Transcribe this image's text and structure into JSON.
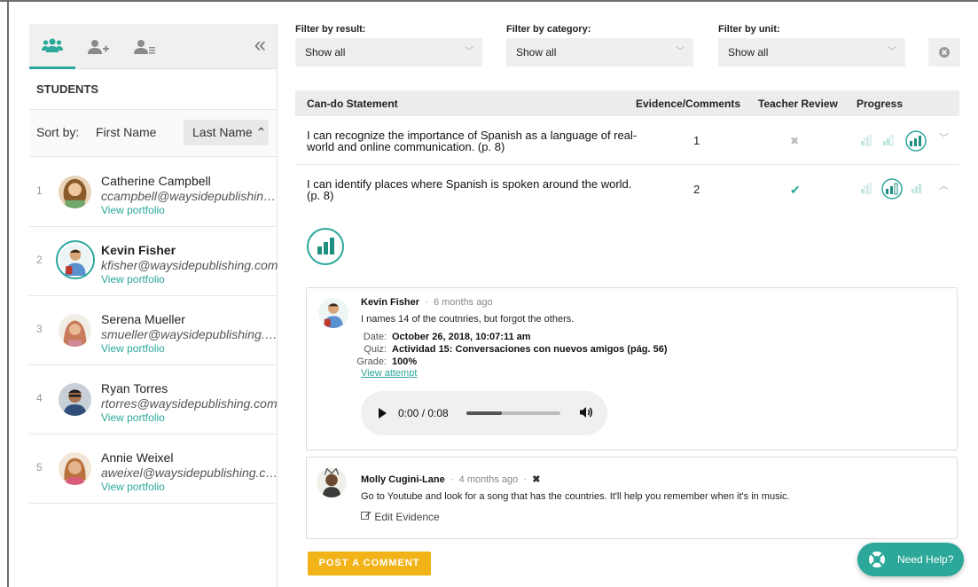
{
  "sidebar": {
    "students_heading": "STUDENTS",
    "sort_label": "Sort by:",
    "sort_first": "First Name",
    "sort_last": "Last Name ⌃",
    "collapse_glyph": "«",
    "students": [
      {
        "num": "1",
        "name": "Catherine Campbell",
        "email": "ccampbell@waysidepublishing.com",
        "portfolio": "View portfolio"
      },
      {
        "num": "2",
        "name": "Kevin Fisher",
        "email": "kfisher@waysidepublishing.com",
        "portfolio": "View portfolio"
      },
      {
        "num": "3",
        "name": "Serena Mueller",
        "email": "smueller@waysidepublishing.com",
        "portfolio": "View portfolio"
      },
      {
        "num": "4",
        "name": "Ryan Torres",
        "email": "rtorres@waysidepublishing.com",
        "portfolio": "View portfolio"
      },
      {
        "num": "5",
        "name": "Annie Weixel",
        "email": "aweixel@waysidepublishing.com",
        "portfolio": "View portfolio"
      }
    ],
    "selected_index": 1
  },
  "filters": {
    "result_label": "Filter by result:",
    "result_value": "Show all",
    "category_label": "Filter by category:",
    "category_value": "Show all",
    "unit_label": "Filter by unit:",
    "unit_value": "Show all"
  },
  "table": {
    "headers": {
      "statement": "Can-do Statement",
      "evidence": "Evidence/Comments",
      "review": "Teacher Review",
      "progress": "Progress"
    },
    "rows": [
      {
        "statement": "I can recognize the importance of Spanish as a language of real-world and online communication. (p. 8)",
        "evidence": "1",
        "review": "✖",
        "progress_level": 3
      },
      {
        "statement": "I can identify places where Spanish is spoken around the world. (p. 8)",
        "evidence": "2",
        "review": "✔",
        "progress_level": 2
      }
    ]
  },
  "comments": [
    {
      "author": "Kevin Fisher",
      "time": "6 months ago",
      "text": "I names 14 of the coutnries, but forgot the others.",
      "date_label": "Date:",
      "date_value": "October 26, 2018, 10:07:11 am",
      "quiz_label": "Quiz:",
      "quiz_value": "Actividad 15: Conversaciones con nuevos amigos (pág. 56)",
      "grade_label": "Grade:",
      "grade_value": "100%",
      "view_attempt": "View attempt",
      "player_time": "0:00 / 0:08",
      "player_progress": 0.38
    },
    {
      "author": "Molly Cugini-Lane",
      "time": "4 months ago",
      "delete_glyph": "✖",
      "text": "Go to Youtube and look for a song that has the countries. It'll help you remember when it's in music.",
      "edit_label": "Edit Evidence"
    }
  ],
  "actions": {
    "post_comment": "POST A COMMENT",
    "need_help": "Need Help?"
  },
  "colors": {
    "accent": "#2ba89a",
    "button_yellow": "#f2b318"
  }
}
